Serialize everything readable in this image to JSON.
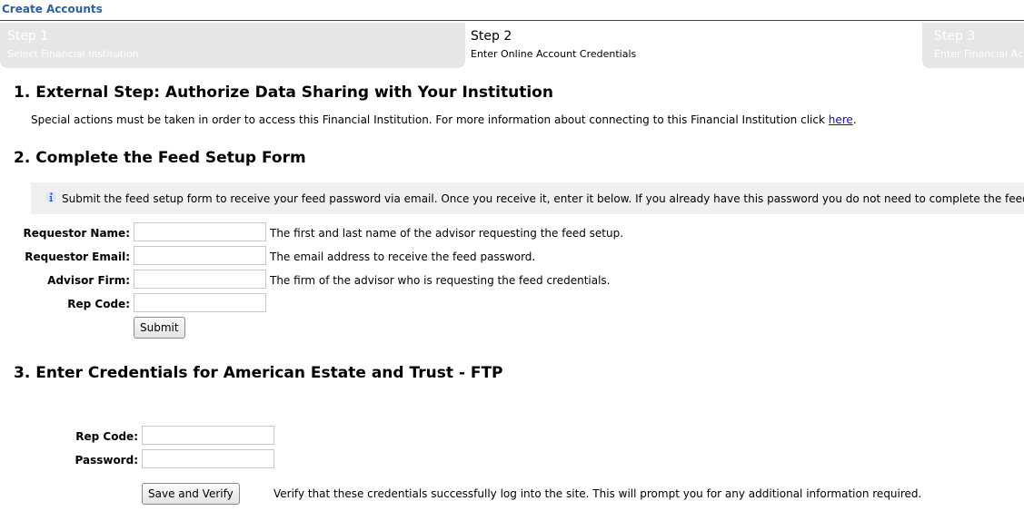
{
  "header": {
    "title": "Create Accounts"
  },
  "steps": [
    {
      "number": "Step 1",
      "description": "Select Financial Institution"
    },
    {
      "number": "Step 2",
      "description": "Enter Online Account Credentials"
    },
    {
      "number": "Step 3",
      "description": "Enter Financial Ac"
    }
  ],
  "section1": {
    "heading": "1. External Step: Authorize Data Sharing with Your Institution",
    "text": "Special actions must be taken in order to access this Financial Institution. For more information about connecting to this Financial Institution click ",
    "link": "here",
    "after_link": "."
  },
  "section2": {
    "heading": "2. Complete the Feed Setup Form",
    "info": "Submit the feed setup form to receive your feed password via email. Once you receive it, enter it below. If you already have this password you do not need to complete the feed setup form.",
    "fields": [
      {
        "label": "Requestor Name:",
        "value": "",
        "help": "The first and last name of the advisor requesting the feed setup."
      },
      {
        "label": "Requestor Email:",
        "value": "",
        "help": "The email address to receive the feed password."
      },
      {
        "label": "Advisor Firm:",
        "value": "",
        "help": "The firm of the advisor who is requesting the feed credentials."
      },
      {
        "label": "Rep Code:",
        "value": "",
        "help": ""
      }
    ],
    "submit_label": "Submit"
  },
  "section3": {
    "heading": "3. Enter Credentials for American Estate and Trust - FTP",
    "fields": [
      {
        "label": "Rep Code:",
        "value": ""
      },
      {
        "label": "Password:",
        "value": ""
      }
    ],
    "button_label": "Save and Verify",
    "verify_text": "Verify that these credentials successfully log into the site. This will prompt you for any additional information required."
  },
  "colors": {
    "title_blue": "#2f5f9e",
    "step_gray": "#e6e6e6",
    "info_bg": "#f0f0f0",
    "link": "#1a0dab"
  },
  "icons": {
    "info": "info-icon"
  }
}
